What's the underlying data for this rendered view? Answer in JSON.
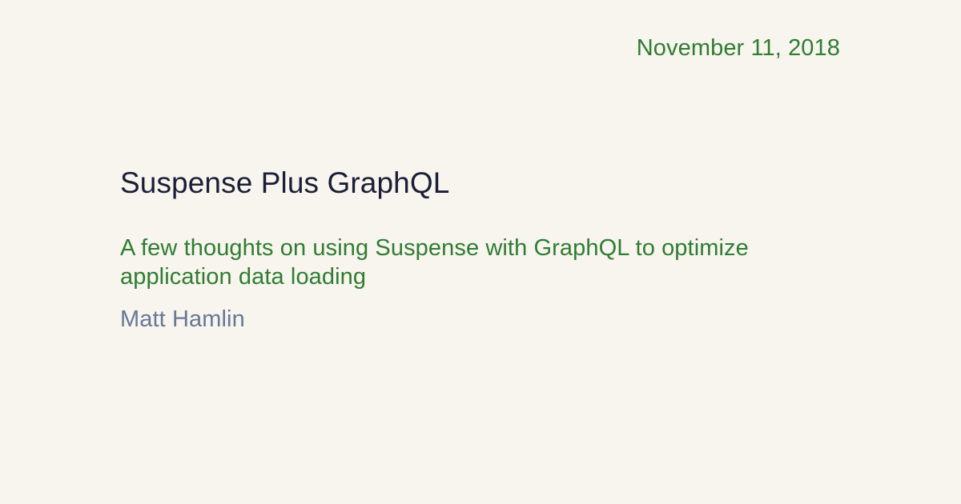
{
  "post": {
    "date": "November 11, 2018",
    "title": "Suspense Plus GraphQL",
    "subtitle": "A few thoughts on using Suspense with GraphQL to optimize application data loading",
    "author": "Matt Hamlin"
  },
  "colors": {
    "background": "#f8f4ee",
    "title": "#1a1f36",
    "accent": "#2f7d32",
    "author": "#667996"
  }
}
